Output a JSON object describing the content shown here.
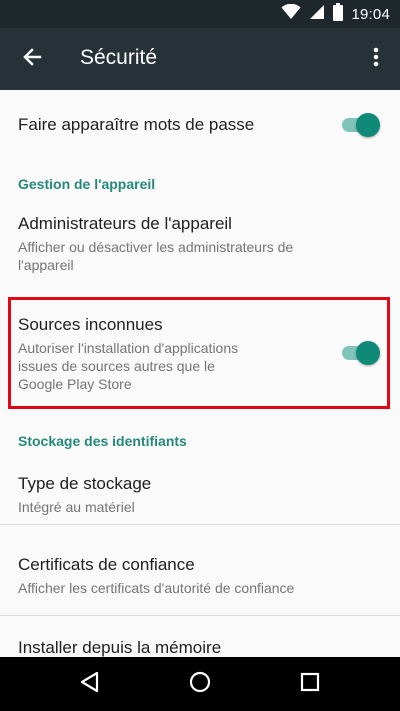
{
  "status_bar": {
    "time": "19:04",
    "icons": [
      "wifi-icon",
      "signal-icon",
      "battery-icon"
    ]
  },
  "app_bar": {
    "title": "Sécurité",
    "back_icon": "arrow-back-icon",
    "more_icon": "more-vert-icon"
  },
  "settings": {
    "show_passwords": {
      "title": "Faire apparaître mots de passe",
      "enabled": true
    },
    "device_admin_category": "Gestion de l'appareil",
    "device_admins": {
      "title": "Administrateurs de l'appareil",
      "summary_line1": "Afficher ou désactiver les administrateurs de",
      "summary_line2": "l'appareil"
    },
    "unknown_sources": {
      "title": "Sources inconnues",
      "summary_line1": "Autoriser l'installation d'applications",
      "summary_line2": "issues de sources autres que le",
      "summary_line3": "Google Play Store",
      "enabled": true
    },
    "credential_storage_category": "Stockage des identifiants",
    "storage_type": {
      "title": "Type de stockage",
      "summary": "Intégré au matériel"
    },
    "trusted_certs": {
      "title": "Certificats de confiance",
      "summary": "Afficher les certificats d'autorité de confiance"
    },
    "install_from_storage": {
      "title": "Installer depuis la mémoire"
    }
  },
  "colors": {
    "accent": "#26897b",
    "switch_thumb": "#0f8a78",
    "switch_track": "#80c3b9",
    "app_bar": "#263238",
    "status_bar": "#1e272b",
    "highlight": "#e30613"
  },
  "nav_bar": {
    "back_icon": "nav-back-icon",
    "home_icon": "nav-home-icon",
    "recents_icon": "nav-recents-icon"
  }
}
